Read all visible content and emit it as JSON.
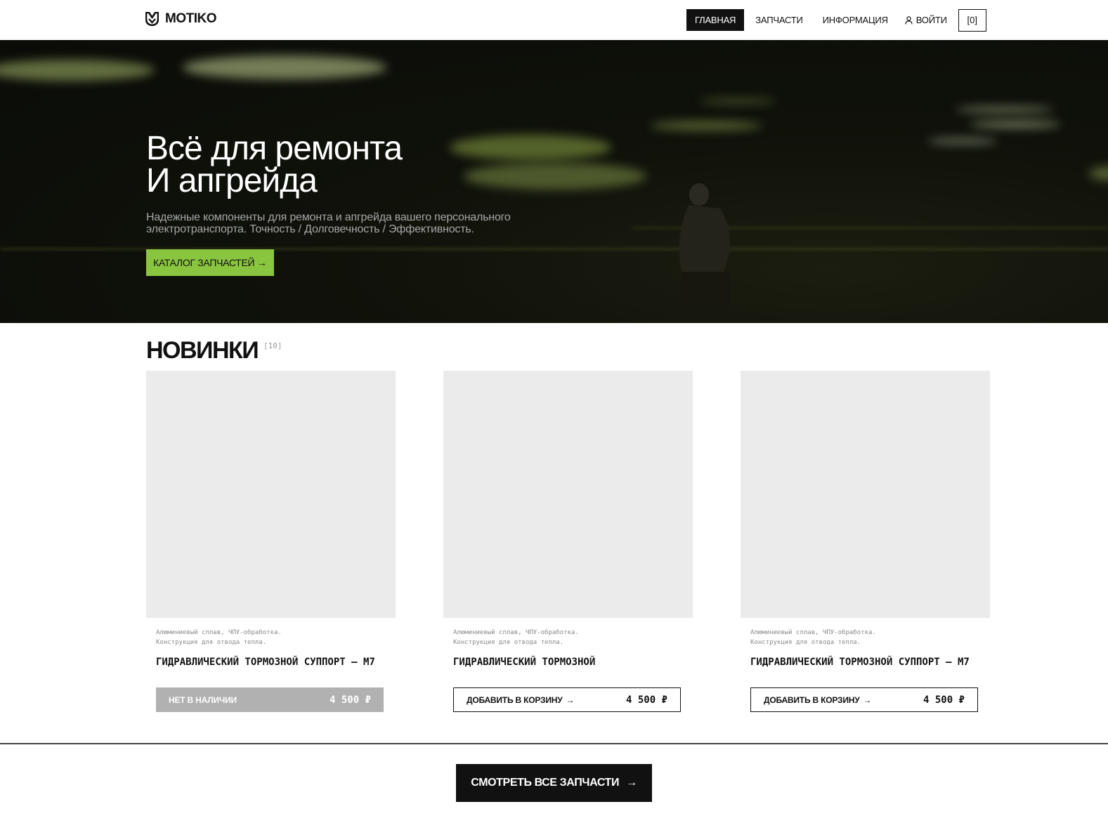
{
  "header": {
    "logo_text": "MOTIKO",
    "nav": [
      {
        "label": "ГЛАВНАЯ",
        "active": true
      },
      {
        "label": "ЗАПЧАСТИ",
        "active": false
      },
      {
        "label": "ИНФОРМАЦИЯ",
        "active": false
      }
    ],
    "login_label": "ВОЙТИ",
    "cart_label": "[0]"
  },
  "hero": {
    "title_line1": "Всё для ремонта",
    "title_line2": "И апгрейда",
    "subtitle": "Надежные компоненты для ремонта и апгрейда вашего персонального электротранспорта. Точность / Долговечность / Эффективность.",
    "button_label": "КАТАЛОГ ЗАПЧАСТЕЙ →"
  },
  "new_section": {
    "title": "НОВИНКИ",
    "count": "[10]"
  },
  "products": [
    {
      "desc_line1": "Алюминиевый сплав, ЧПУ-обработка.",
      "desc_line2": "Конструкция для отвода тепла.",
      "name": "ГИДРАВЛИЧЕСКИЙ ТОРМОЗНОЙ СУППОРТ – M7",
      "action_label": "НЕТ В НАЛИЧИИ",
      "price": "4 500 ₽",
      "in_stock": false
    },
    {
      "desc_line1": "Алюминиевый сплав, ЧПУ-обработка.",
      "desc_line2": "Конструкция для отвода тепла.",
      "name": "ГИДРАВЛИЧЕСКИЙ ТОРМОЗНОЙ",
      "action_label": "ДОБАВИТЬ В КОРЗИНУ",
      "price": "4 500 ₽",
      "in_stock": true
    },
    {
      "desc_line1": "Алюминиевый сплав, ЧПУ-обработка.",
      "desc_line2": "Конструкция для отвода тепла.",
      "name": "ГИДРАВЛИЧЕСКИЙ ТОРМОЗНОЙ СУППОРТ – M7",
      "action_label": "ДОБАВИТЬ В КОРЗИНУ",
      "price": "4 500 ₽",
      "in_stock": true
    }
  ],
  "footer": {
    "all_parts_label": "СМОТРЕТЬ ВСЕ ЗАПЧАСТИ"
  },
  "colors": {
    "accent": "#8ac53f",
    "dark": "#111111",
    "out_of_stock": "#b1b1b1",
    "placeholder": "#ebebeb"
  },
  "icons": {
    "logo": "moto-logo-icon",
    "login": "user-icon",
    "arrow": "arrow-right-icon"
  }
}
